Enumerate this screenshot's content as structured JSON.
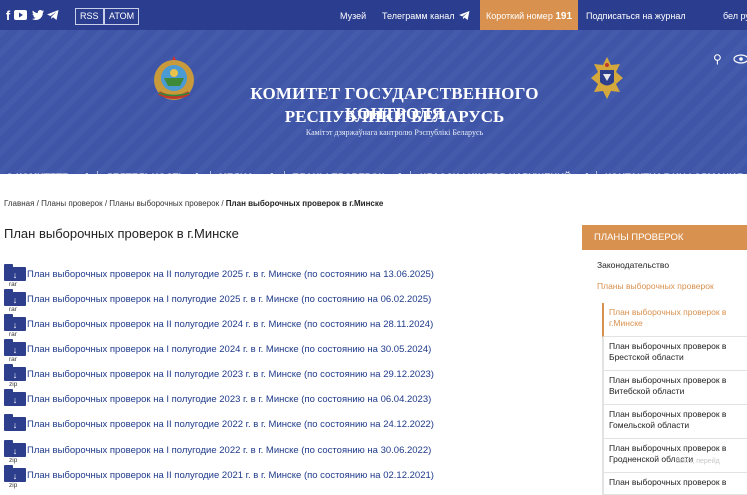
{
  "topbar": {
    "social_icons": [
      "facebook-icon",
      "youtube-icon",
      "twitter-icon",
      "telegram-icon"
    ],
    "rss": "RSS",
    "atom": "ATOM",
    "links": [
      "Музей",
      "Телеграмм канал",
      "Подписаться на журнал",
      "бел ру"
    ],
    "short_number_label": "Короткий номер",
    "short_number": "191"
  },
  "header": {
    "title_line1": "КОМИТЕТ ГОСУДАРСТВЕННОГО КОНТРОЛЯ",
    "title_line2": "РЕСПУБЛИКИ БЕЛАРУСЬ",
    "subtitle": "Камітэт дзяржаўнага кантролю Рэспублікі Беларусь"
  },
  "nav": [
    "О КОМИТЕТЕ",
    "ДЕЯТЕЛЬНОСТЬ",
    "МЕДИА",
    "ПЛАНЫ ПРОВЕРОК",
    "КЛАССИФИКАТОР НАРУШЕНИЙ",
    "КОНТАКТНАЯ ИНФОРМАЦИЯ"
  ],
  "breadcrumb": {
    "items": [
      "Главная",
      "Планы проверок",
      "Планы выборочных проверок"
    ],
    "current": "План выборочных проверок в г.Минске",
    "separator": " / "
  },
  "page_title": "План выборочных проверок в г.Минске",
  "documents": [
    {
      "title": "План выборочных проверок на II полугодие 2025 г. в г. Минске (по состоянию на 13.06.2025)",
      "ext": "rar"
    },
    {
      "title": "План выборочных проверок на I полугодие 2025 г. в г. Минске (по состоянию на 06.02.2025)",
      "ext": "rar"
    },
    {
      "title": "План выборочных проверок на II полугодие 2024 г. в г. Минске (по состоянию на 28.11.2024)",
      "ext": "rar"
    },
    {
      "title": "План выборочных проверок на I полугодие 2024 г. в г. Минске (по состоянию на 30.05.2024)",
      "ext": "rar"
    },
    {
      "title": "План выборочных проверок на II полугодие 2023 г. в г. Минске (по состоянию на 29.12.2023)",
      "ext": "zip"
    },
    {
      "title": "План выборочных проверок на I полугодие 2023 г. в г. Минске (по состоянию на 06.04.2023)",
      "ext": ""
    },
    {
      "title": "План выборочных проверок на II полугодие 2022 г. в г. Минске (по состоянию на 24.12.2022)",
      "ext": ""
    },
    {
      "title": "План выборочных проверок на I полугодие 2022 г. в г. Минске (по состоянию на 30.06.2022)",
      "ext": "zip"
    },
    {
      "title": "План выборочных проверок на II полугодие 2021 г. в г. Минске (по состоянию на 02.12.2021)",
      "ext": "zip"
    }
  ],
  "sidebar": {
    "heading": "ПЛАНЫ ПРОВЕРОК",
    "items": [
      "Законодательство",
      "Планы выборочных проверок"
    ],
    "subitems": [
      "План выборочных проверок в г.Минске",
      "План выборочных проверок в Брестской области",
      "План выборочных проверок в Витебской области",
      "План выборочных проверок в Гомельской области",
      "План выборочных проверок в Гродненской области",
      "План выборочных проверок в"
    ]
  },
  "watermark": "dows, перейд",
  "colors": {
    "primary": "#2a3d8f",
    "header": "#3e55a8",
    "accent": "#d9914f",
    "link": "#1e3a8a"
  }
}
